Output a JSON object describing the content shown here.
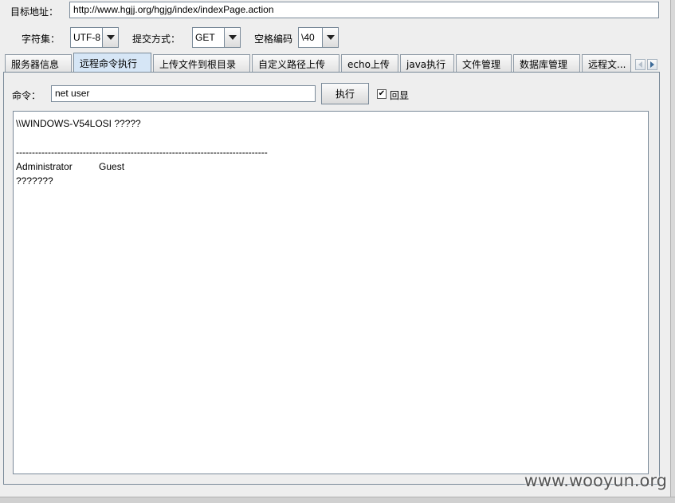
{
  "target": {
    "label": "目标地址：",
    "url": "http://www.hgjj.org/hgjg/index/indexPage.action"
  },
  "options": {
    "charset_label": "字符集：",
    "charset_value": "UTF-8",
    "method_label": "提交方式：",
    "method_value": "GET",
    "space_label": "空格编码",
    "space_value": "\\40"
  },
  "tabs": [
    {
      "label": "服务器信息",
      "active": false
    },
    {
      "label": "远程命令执行",
      "active": true
    },
    {
      "label": "上传文件到根目录",
      "active": false
    },
    {
      "label": "自定义路径上传",
      "active": false
    },
    {
      "label": "echo上传",
      "active": false
    },
    {
      "label": "java执行",
      "active": false
    },
    {
      "label": "文件管理",
      "active": false
    },
    {
      "label": "数据库管理",
      "active": false
    },
    {
      "label": "远程文...",
      "active": false
    }
  ],
  "command": {
    "label": "命令：",
    "value": "net user",
    "execute_label": "执行",
    "echo_label": "回显",
    "echo_checked": "✔"
  },
  "output": {
    "lines": [
      "\\\\WINDOWS-V54LOSI ?????",
      "",
      "-------------------------------------------------------------------------------",
      "Administrator          Guest",
      "???????"
    ]
  },
  "watermark": "www.wooyun.org",
  "colors": {
    "active_tab": "#d6e6f6",
    "border": "#7a8a99",
    "background": "#eeeeee"
  }
}
